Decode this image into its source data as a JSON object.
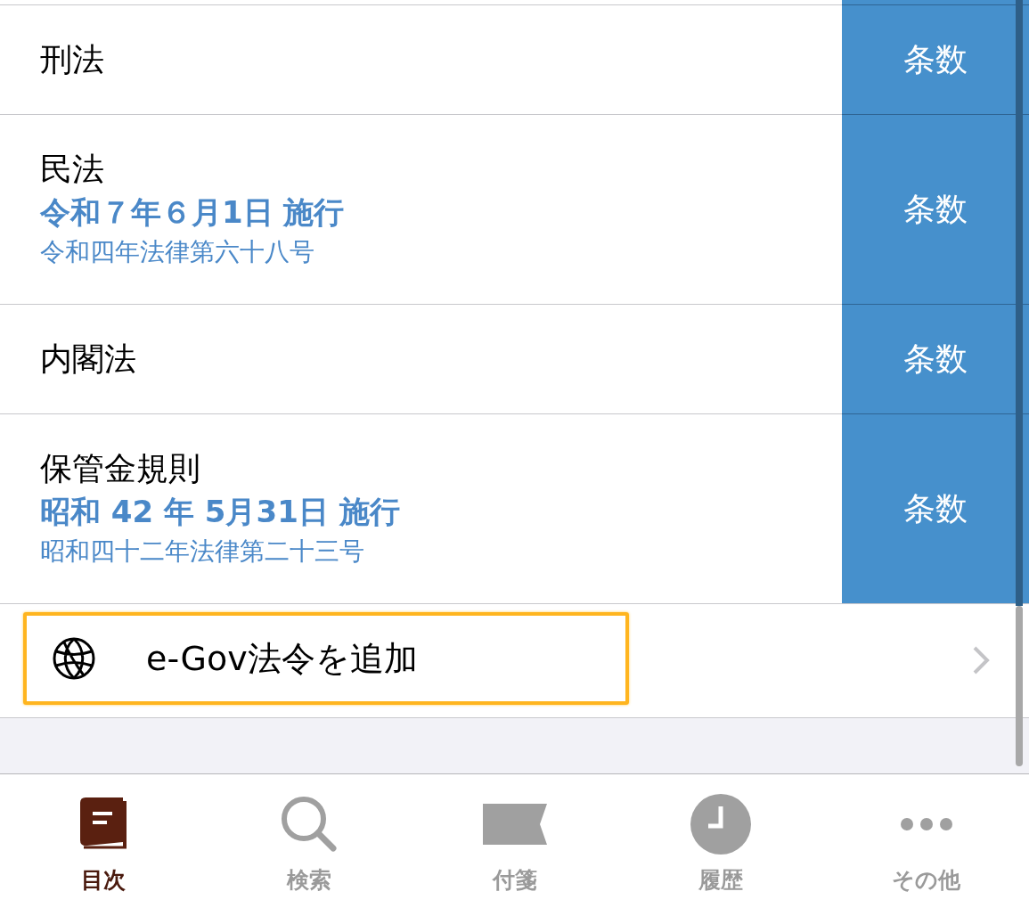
{
  "laws": [
    {
      "name": "刑法",
      "action": "条数"
    },
    {
      "name": "民法",
      "enforced": "令和７年６月1日 施行",
      "law_number": "令和四年法律第六十八号",
      "action": "条数"
    },
    {
      "name": "内閣法",
      "action": "条数"
    },
    {
      "name": "保管金規則",
      "enforced": "昭和 42 年 5月31日 施行",
      "law_number": "昭和四十二年法律第二十三号",
      "action": "条数"
    }
  ],
  "add_item": {
    "label": "e-Gov法令を追加",
    "highlighted": true
  },
  "tabs": [
    {
      "kind": "book",
      "label": "目次",
      "selected": true
    },
    {
      "kind": "search",
      "label": "検索",
      "selected": false
    },
    {
      "kind": "flag",
      "label": "付箋",
      "selected": false
    },
    {
      "kind": "clock",
      "label": "履歴",
      "selected": false
    },
    {
      "kind": "more",
      "label": "その他",
      "selected": false
    }
  ]
}
